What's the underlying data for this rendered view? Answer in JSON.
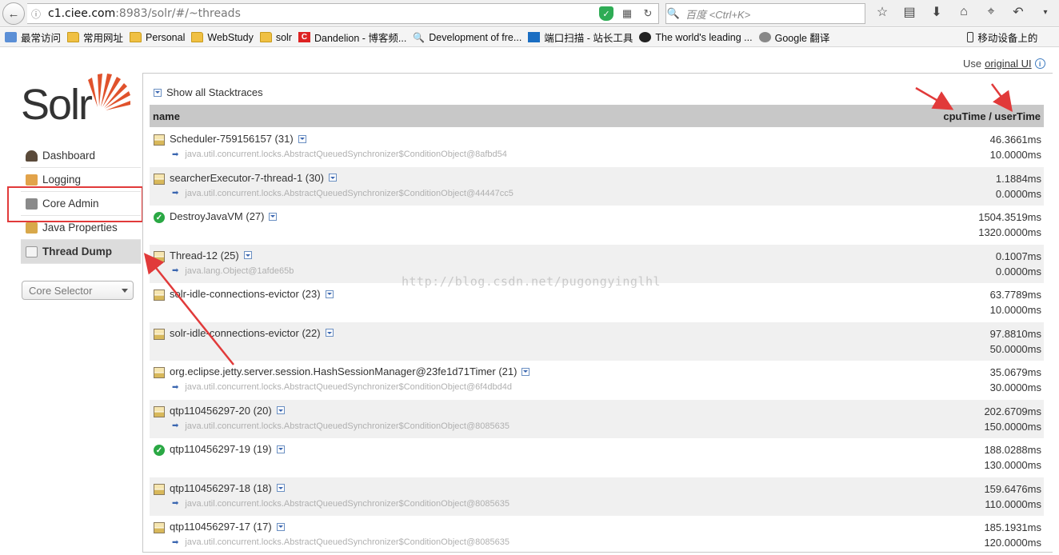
{
  "browser": {
    "url_host": "c1.ciee.com",
    "url_rest": ":8983/solr/#/~threads",
    "search_placeholder": "百度 <Ctrl+K>"
  },
  "bookmarks": [
    {
      "label": "最常访问",
      "icon": "globe-icon"
    },
    {
      "label": "常用网址",
      "icon": "folder-icon"
    },
    {
      "label": "Personal",
      "icon": "folder-icon"
    },
    {
      "label": "WebStudy",
      "icon": "folder-icon"
    },
    {
      "label": "solr",
      "icon": "folder-icon"
    },
    {
      "label": "Dandelion - 博客频...",
      "icon": "red-c-icon"
    },
    {
      "label": "Development of fre...",
      "icon": "magnifier-icon"
    },
    {
      "label": "端口扫描 - 站长工具",
      "icon": "blue-icon"
    },
    {
      "label": "The world's leading ...",
      "icon": "github-icon"
    },
    {
      "label": "Google 翻译",
      "icon": "globe-icon"
    },
    {
      "label": "移动设备上的",
      "icon": "mobile-icon"
    }
  ],
  "sidebar": {
    "logo_text": "Solr",
    "items": [
      {
        "label": "Dashboard",
        "icon": "dashboard-icon",
        "color": "#5a4a3a"
      },
      {
        "label": "Logging",
        "icon": "logging-icon",
        "color": "#e2a34a"
      },
      {
        "label": "Core Admin",
        "icon": "core-admin-icon",
        "color": "#8a8a8a"
      },
      {
        "label": "Java Properties",
        "icon": "java-icon",
        "color": "#d8a84a"
      },
      {
        "label": "Thread Dump",
        "icon": "thread-dump-icon",
        "color": "#999999"
      }
    ],
    "core_selector": "Core Selector"
  },
  "header": {
    "use_text": "Use",
    "original_ui": "original UI"
  },
  "threads": {
    "show_all": "Show all Stacktraces",
    "col_name": "name",
    "col_time": "cpuTime / userTime",
    "rows": [
      {
        "name": "Scheduler-759156157 (31)",
        "state": "waiting",
        "lock": "java.util.concurrent.locks.AbstractQueuedSynchronizer$ConditionObject@8afbd54",
        "cpu": "46.3661ms",
        "user": "10.0000ms"
      },
      {
        "name": "searcherExecutor-7-thread-1 (30)",
        "state": "waiting",
        "lock": "java.util.concurrent.locks.AbstractQueuedSynchronizer$ConditionObject@44447cc5",
        "cpu": "1.1884ms",
        "user": "0.0000ms"
      },
      {
        "name": "DestroyJavaVM (27)",
        "state": "runnable",
        "lock": "",
        "cpu": "1504.3519ms",
        "user": "1320.0000ms"
      },
      {
        "name": "Thread-12 (25)",
        "state": "waiting",
        "lock": "java.lang.Object@1afde65b",
        "cpu": "0.1007ms",
        "user": "0.0000ms"
      },
      {
        "name": "solr-idle-connections-evictor (23)",
        "state": "waiting",
        "lock": "",
        "cpu": "63.7789ms",
        "user": "10.0000ms"
      },
      {
        "name": "solr-idle-connections-evictor (22)",
        "state": "waiting",
        "lock": "",
        "cpu": "97.8810ms",
        "user": "50.0000ms"
      },
      {
        "name": "org.eclipse.jetty.server.session.HashSessionManager@23fe1d71Timer (21)",
        "state": "waiting",
        "lock": "java.util.concurrent.locks.AbstractQueuedSynchronizer$ConditionObject@6f4dbd4d",
        "cpu": "35.0679ms",
        "user": "30.0000ms"
      },
      {
        "name": "qtp110456297-20 (20)",
        "state": "waiting",
        "lock": "java.util.concurrent.locks.AbstractQueuedSynchronizer$ConditionObject@8085635",
        "cpu": "202.6709ms",
        "user": "150.0000ms"
      },
      {
        "name": "qtp110456297-19 (19)",
        "state": "runnable",
        "lock": "",
        "cpu": "188.0288ms",
        "user": "130.0000ms"
      },
      {
        "name": "qtp110456297-18 (18)",
        "state": "waiting",
        "lock": "java.util.concurrent.locks.AbstractQueuedSynchronizer$ConditionObject@8085635",
        "cpu": "159.6476ms",
        "user": "110.0000ms"
      },
      {
        "name": "qtp110456297-17 (17)",
        "state": "waiting",
        "lock": "java.util.concurrent.locks.AbstractQueuedSynchronizer$ConditionObject@8085635",
        "cpu": "185.1931ms",
        "user": "120.0000ms"
      }
    ]
  },
  "watermark": "http://blog.csdn.net/pugongyinglhl",
  "colors": {
    "accent_red": "#e13a3a",
    "header_gray": "#c8c8c8",
    "logo_orange": "#e0522c"
  }
}
